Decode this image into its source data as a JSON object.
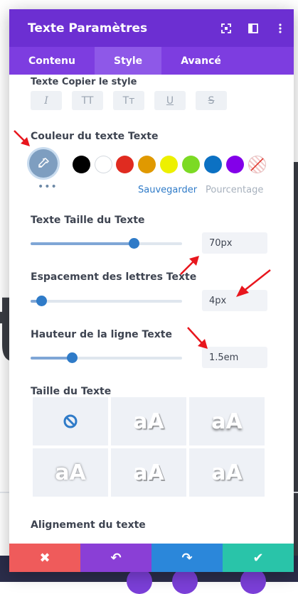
{
  "modal": {
    "title": "Texte Paramètres",
    "header_icons": [
      "expand-icon",
      "sidebar-layout-icon",
      "more-vertical-icon"
    ],
    "tabs": [
      {
        "label": "Contenu",
        "active": false
      },
      {
        "label": "Style",
        "active": true
      },
      {
        "label": "Avancé",
        "active": false
      }
    ]
  },
  "style_section": {
    "label": "Texte Copier le style",
    "buttons": [
      {
        "glyph": "I",
        "name": "italic"
      },
      {
        "glyph": "TT",
        "name": "uppercase"
      },
      {
        "glyph": "Tт",
        "name": "capitalize"
      },
      {
        "glyph": "U",
        "name": "underline"
      },
      {
        "glyph": "S",
        "name": "strikethrough"
      }
    ]
  },
  "color_section": {
    "label": "Couleur du texte Texte",
    "swatches": [
      "#000000",
      "#ffffff",
      "#e02b20",
      "#e09900",
      "#edf000",
      "#7cda24",
      "#0c71c3",
      "#8300e9"
    ],
    "dots": "•••",
    "save_label": "Sauvegarder",
    "percent_label": "Pourcentage"
  },
  "text_size": {
    "label": "Texte Taille du Texte",
    "value": "70px",
    "slider_fraction": 0.68
  },
  "letter_spacing": {
    "label": "Espacement des lettres Texte",
    "value": "4px",
    "slider_fraction": 0.07
  },
  "line_height": {
    "label": "Hauteur de la ligne Texte",
    "value": "1.5em",
    "slider_fraction": 0.27
  },
  "text_shadow": {
    "label": "Taille du Texte",
    "none_icon": "no-shadow-icon",
    "sample_text": "aA"
  },
  "alignment": {
    "label": "Alignement du texte"
  },
  "footer": {
    "cancel": "✖",
    "undo": "↶",
    "redo": "↷",
    "save": "✔"
  },
  "colors": {
    "header": "#6c2fd2",
    "tabs": "#7d3de0",
    "accent_blue": "#2f7bc8",
    "cancel": "#ef5b5b",
    "undo": "#8a3fd6",
    "redo": "#2b87da",
    "save": "#29c4a9",
    "arrow": "#e8161d"
  }
}
